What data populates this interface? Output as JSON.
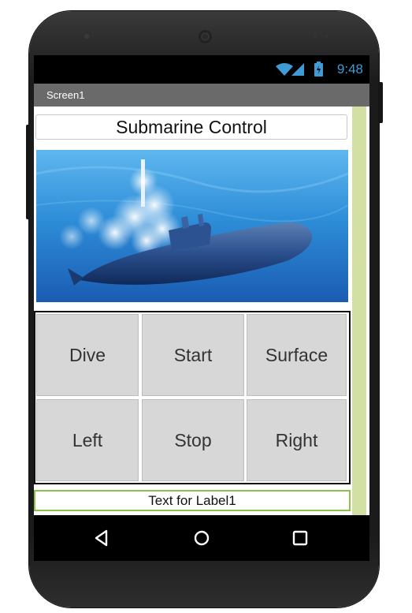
{
  "status_bar": {
    "time": "9:48",
    "icons": [
      "wifi-icon",
      "signal-icon",
      "battery-icon"
    ]
  },
  "screen": {
    "title": "Screen1"
  },
  "app": {
    "title": "Submarine Control"
  },
  "buttons": {
    "dive": "Dive",
    "start": "Start",
    "surface": "Surface",
    "left": "Left",
    "stop": "Stop",
    "right": "Right"
  },
  "label1": {
    "text": "Text for Label1"
  },
  "nav": {
    "icons": [
      "back-icon",
      "home-icon",
      "recents-icon"
    ]
  },
  "colors": {
    "status_text": "#3f9bd5",
    "title_bar": "#6a6a6a",
    "button_bg": "#d7d7d7",
    "label_border": "#8bc34a",
    "side_strip": "#d2e0a4"
  }
}
